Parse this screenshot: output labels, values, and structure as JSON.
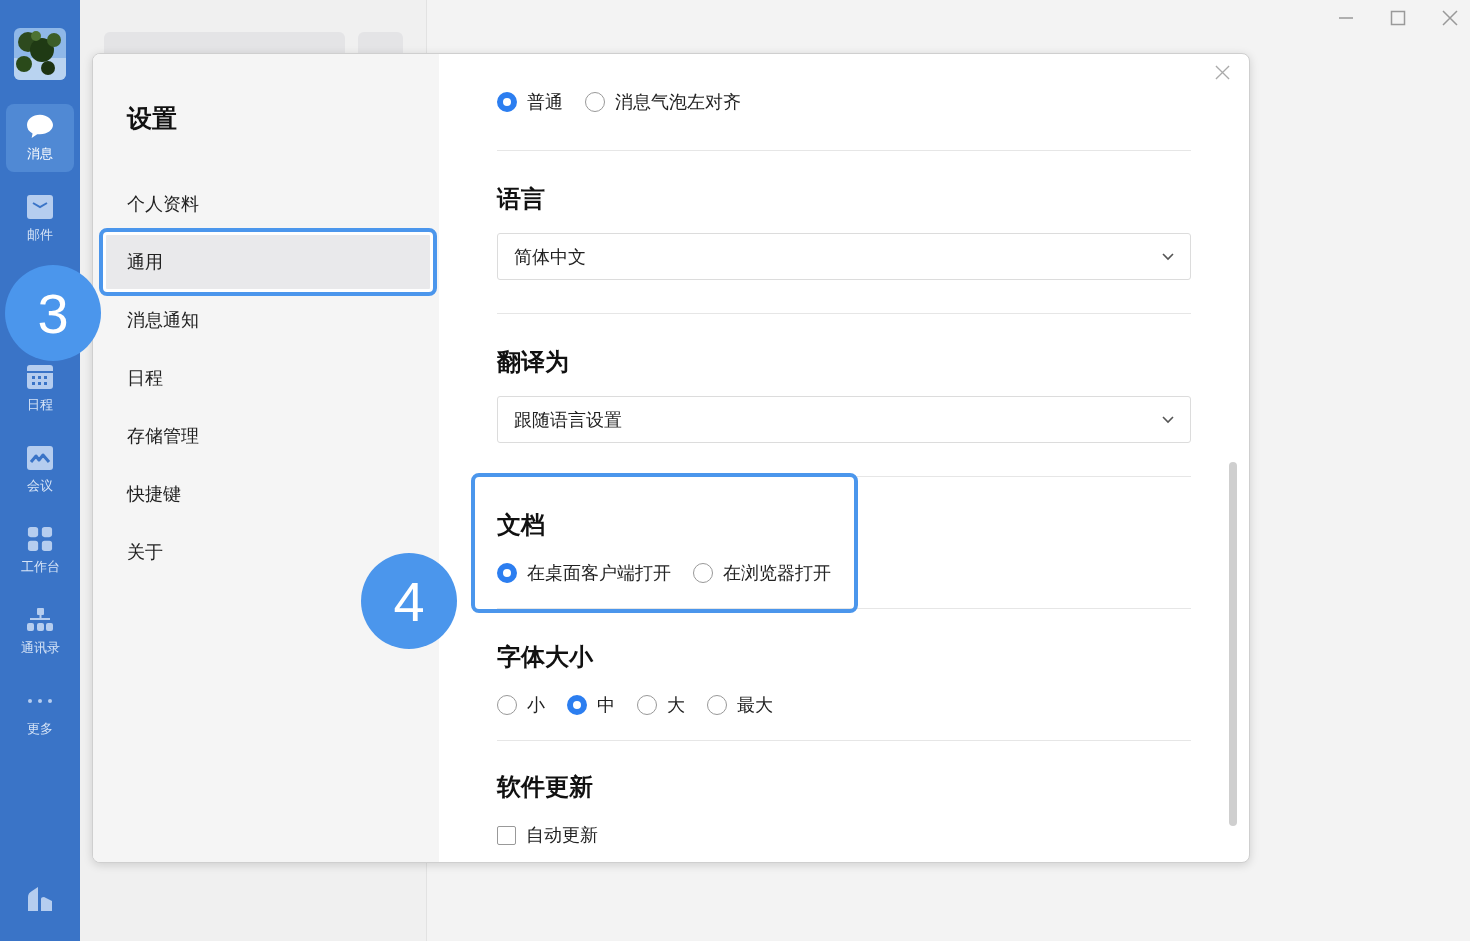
{
  "sidebar": {
    "items": [
      {
        "label": "消息",
        "selected": true
      },
      {
        "label": "邮件",
        "selected": false
      },
      {
        "label": "日程",
        "selected": false
      },
      {
        "label": "会议",
        "selected": false
      },
      {
        "label": "工作台",
        "selected": false
      },
      {
        "label": "通讯录",
        "selected": false
      },
      {
        "label": "更多",
        "selected": false
      }
    ]
  },
  "settings": {
    "title": "设置",
    "nav": [
      {
        "label": "个人资料",
        "selected": false
      },
      {
        "label": "通用",
        "selected": true,
        "highlighted": true
      },
      {
        "label": "消息通知",
        "selected": false
      },
      {
        "label": "日程",
        "selected": false
      },
      {
        "label": "存储管理",
        "selected": false
      },
      {
        "label": "快捷键",
        "selected": false
      },
      {
        "label": "关于",
        "selected": false
      }
    ],
    "sections": [
      {
        "kind": "radio",
        "options": [
          {
            "label": "普通",
            "selected": true
          },
          {
            "label": "消息气泡左对齐",
            "selected": false
          }
        ]
      },
      {
        "kind": "select",
        "title": "语言",
        "value": "简体中文"
      },
      {
        "kind": "select",
        "title": "翻译为",
        "value": "跟随语言设置"
      },
      {
        "kind": "radio",
        "title": "文档",
        "highlighted": true,
        "options": [
          {
            "label": "在桌面客户端打开",
            "selected": true
          },
          {
            "label": "在浏览器打开",
            "selected": false
          }
        ]
      },
      {
        "kind": "radio",
        "title": "字体大小",
        "options": [
          {
            "label": "小",
            "selected": false
          },
          {
            "label": "中",
            "selected": true
          },
          {
            "label": "大",
            "selected": false
          },
          {
            "label": "最大",
            "selected": false
          }
        ]
      },
      {
        "kind": "checkbox",
        "title": "软件更新",
        "options": [
          {
            "label": "自动更新",
            "checked": false
          }
        ]
      }
    ]
  },
  "callouts": [
    {
      "label": "3"
    },
    {
      "label": "4"
    }
  ]
}
